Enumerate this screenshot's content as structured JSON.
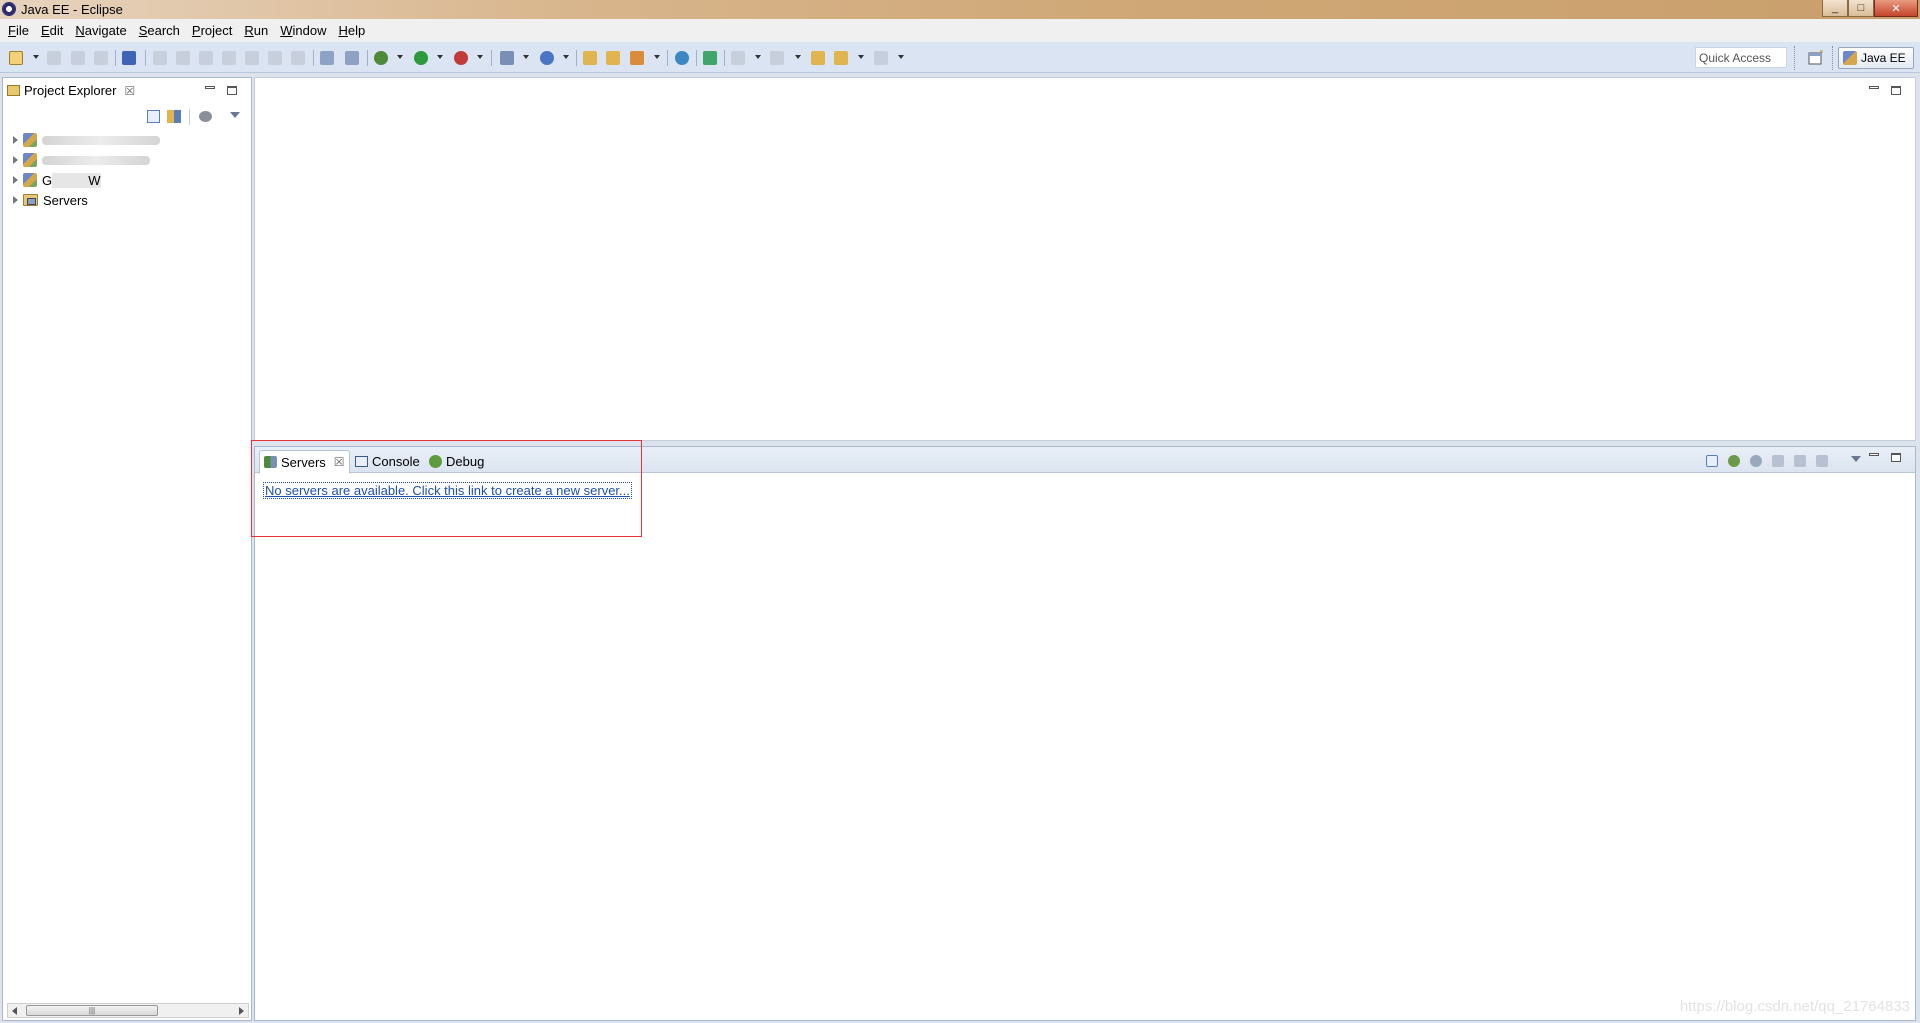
{
  "window": {
    "title": "Java EE - Eclipse",
    "controls": {
      "minimize": "_",
      "restore": "□",
      "close": "✕"
    }
  },
  "menubar": [
    "File",
    "Edit",
    "Navigate",
    "Search",
    "Project",
    "Run",
    "Window",
    "Help"
  ],
  "toolbar": {
    "quick_access_placeholder": "Quick Access",
    "perspective_label": "Java EE"
  },
  "project_explorer": {
    "title": "Project Explorer",
    "close_glyph": "☒",
    "items": [
      {
        "label": "",
        "type": "project"
      },
      {
        "label": "",
        "type": "project"
      },
      {
        "label": "G          W",
        "type": "project"
      },
      {
        "label": "Servers",
        "type": "servers-folder"
      }
    ],
    "scroll_thumb_glyph": "|||"
  },
  "bottom_panel": {
    "tabs": [
      {
        "label": "Servers",
        "icon": "servers-icon",
        "active": true
      },
      {
        "label": "Console",
        "icon": "console-icon",
        "active": false
      },
      {
        "label": "Debug",
        "icon": "debug-icon",
        "active": false
      }
    ],
    "close_glyph": "☒",
    "servers_empty_link": "No servers are available. Click this link to create a new server..."
  },
  "watermark": "https://blog.csdn.net/qq_21764833",
  "colors": {
    "accent_link": "#1f4fa8",
    "highlight_border": "#e8313b",
    "toolbar_bg": "#dae4f2"
  }
}
